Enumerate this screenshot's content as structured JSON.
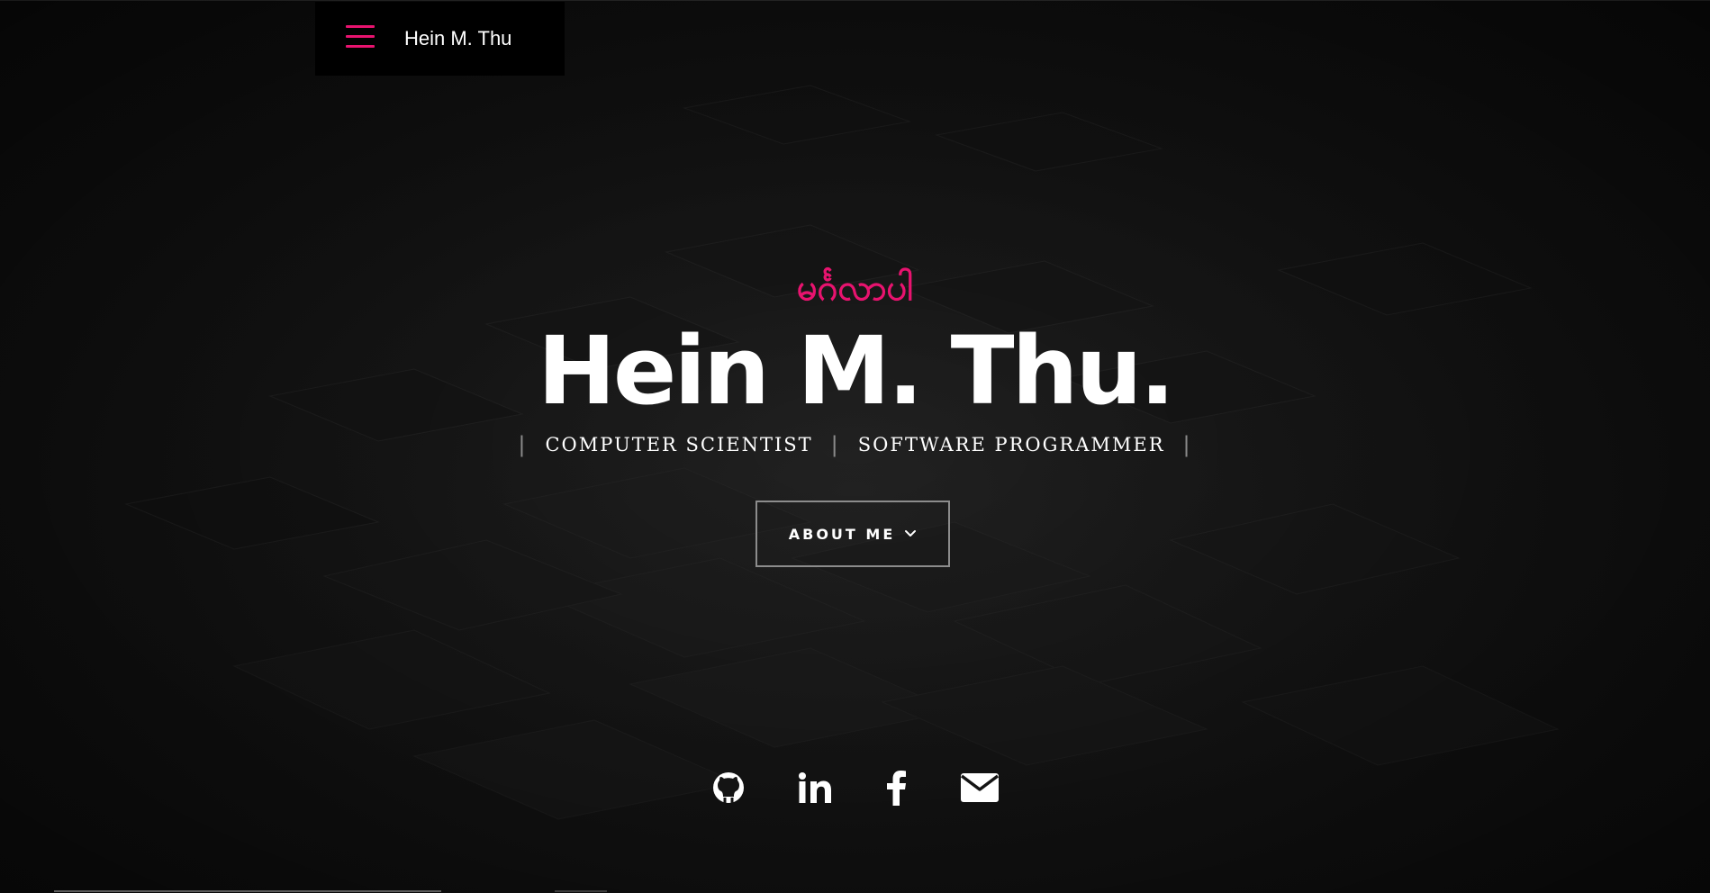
{
  "header": {
    "brand": "Hein M. Thu",
    "menu_icon": "hamburger-menu-icon",
    "accent_color": "#e8136f"
  },
  "hero": {
    "greeting": "မင်္ဂလာပါ",
    "name": "Hein M. Thu.",
    "roles": [
      "COMPUTER SCIENTIST",
      "SOFTWARE PROGRAMMER"
    ],
    "separator": "|",
    "button_label": "ABOUT ME",
    "button_icon": "chevron-down-icon"
  },
  "social": [
    {
      "icon": "github-icon"
    },
    {
      "icon": "linkedin-icon"
    },
    {
      "icon": "facebook-icon"
    },
    {
      "icon": "envelope-icon"
    }
  ],
  "colors": {
    "background": "#141414",
    "accent": "#e8136f",
    "text": "#ffffff",
    "button_border": "#8c8c8c"
  }
}
